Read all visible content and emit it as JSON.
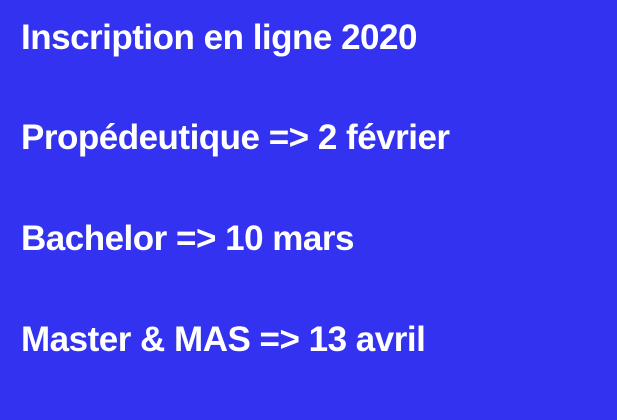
{
  "background_color": "#3232f0",
  "text_color": "#ffffff",
  "lines": [
    "Inscription en ligne 2020",
    "Propédeutique => 2 février",
    "Bachelor => 10 mars",
    "Master & MAS => 13 avril"
  ]
}
